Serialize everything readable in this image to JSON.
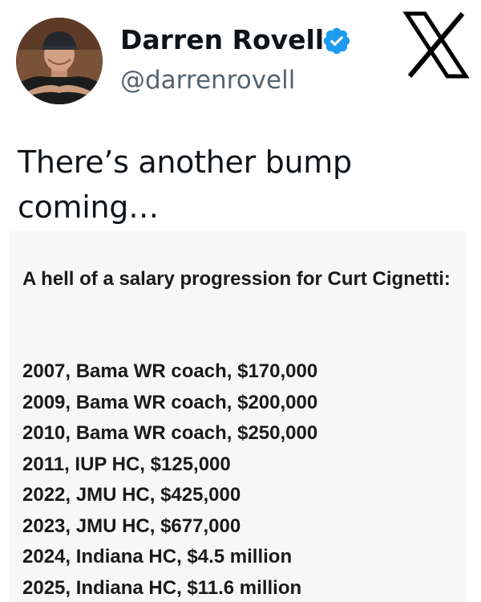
{
  "author": {
    "display_name": "Darren Rovell",
    "handle": "@darrenrovell",
    "verified": true,
    "icons": {
      "avatar": "profile-photo",
      "verified": "verified-badge-icon",
      "platform": "x-logo-icon"
    },
    "colors": {
      "verified_badge": "#1d9bf0",
      "handle": "#536471"
    }
  },
  "tweet": {
    "text": "There’s another bump coming…"
  },
  "quote": {
    "heading": "A hell of a salary progression for Curt Cignetti:",
    "rows": [
      "2007, Bama WR coach, $170,000",
      "2009, Bama WR coach, $200,000",
      "2010, Bama WR coach, $250,000",
      "2011, IUP HC, $125,000",
      "2022, JMU HC, $425,000",
      "2023, JMU HC, $677,000",
      "2024, Indiana HC, $4.5 million",
      "2025, Indiana HC, $11.6 million"
    ]
  }
}
